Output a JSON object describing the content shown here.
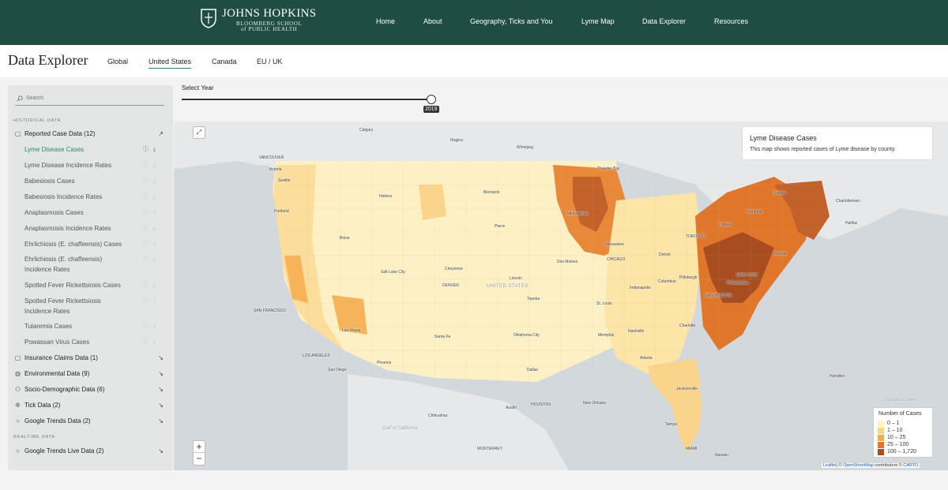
{
  "header": {
    "logo_title": "JOHNS HOPKINS",
    "logo_sub1": "BLOOMBERG SCHOOL",
    "logo_sub2": "of PUBLIC HEALTH",
    "nav": [
      "Home",
      "About",
      "Geography, Ticks and You",
      "Lyme Map",
      "Data Explorer",
      "Resources"
    ]
  },
  "subheader": {
    "title": "Data Explorer",
    "tabs": [
      "Global",
      "United States",
      "Canada",
      "EU / UK"
    ],
    "active_tab": "United States"
  },
  "year": {
    "label": "Select Year",
    "value": "2019"
  },
  "sidebar": {
    "search_placeholder": "Search",
    "historical_label": "HISTORICAL DATA",
    "realtime_label": "REALTIME DATA",
    "reported": {
      "label": "Reported Case Data (12)",
      "items": [
        "Lyme Disease Cases",
        "Lyme Disease Incidence Rates",
        "Babesiosis Cases",
        "Babesiosis Incidence Rates",
        "Anaplasmosis Cases",
        "Anaplasmosis Incidence Rates",
        "Ehrlichiosis (E. chaffeensis) Cases",
        "Ehrlichiosis (E. chaffeensis)",
        "Incidence Rates",
        "Spotted Fever Rickettsiosis Cases",
        "Spotted Fever Rickettsiosis",
        "Incidence Rates",
        "Tularemia Cases",
        "Powassan Virus Cases"
      ]
    },
    "groups": [
      "Insurance Claims Data (1)",
      "Environmental Data (9)",
      "Socio-Demographic Data (6)",
      "Tick Data (2)",
      "Google Trends Data (2)"
    ],
    "realtime_group": "Google Trends Live Data (2)"
  },
  "map": {
    "info_title": "Lyme Disease Cases",
    "info_desc": "This map shows reported cases of Lyme disease by county.",
    "legend_title": "Number of Cases",
    "legend": [
      {
        "label": "0 – 1",
        "color": "#fff3c4"
      },
      {
        "label": "1 – 10",
        "color": "#fbd48b"
      },
      {
        "label": "10 – 25",
        "color": "#f6a94a"
      },
      {
        "label": "25 – 100",
        "color": "#e0762a"
      },
      {
        "label": "100 – 1,720",
        "color": "#a84d1f"
      }
    ],
    "attribution_leaflet": "Leaflet",
    "attribution_osm": "OpenStreetMap",
    "attribution_mid": "| © ",
    "attribution_contrib": " contributors © ",
    "attribution_carto": "CARTO",
    "labels": {
      "calgary": "Calgary",
      "regina": "Regina",
      "winnipeg": "Winnipeg",
      "vancouver": "VANCOUVER",
      "victoria": "Victoria",
      "seattle": "Seattle",
      "portland": "Portland",
      "helena": "Helena",
      "bismarck": "Bismarck",
      "boise": "Boise",
      "pierre": "Pierre",
      "salt_lake": "Salt Lake City",
      "cheyenne": "Cheyenne",
      "denver": "DENVER",
      "united_states": "UNITED STATES",
      "san_francisco": "SAN FRANCISCO",
      "las_vegas": "Las Vegas",
      "los_angeles": "LOS ANGELES",
      "san_diego": "San Diego",
      "phoenix": "Phoenix",
      "santa_fe": "Santa Fe",
      "oklahoma_city": "Oklahoma City",
      "dallas": "Dallas",
      "austin": "Austin",
      "houston": "HOUSTON",
      "new_orleans": "New Orleans",
      "atlanta": "Atlanta",
      "nashville": "Nashville",
      "chicago": "CHICAGO",
      "milwaukee": "Milwaukee",
      "detroit": "Detroit",
      "toronto": "TORONTO",
      "ottawa": "Ottawa",
      "montreal": "Montréal",
      "quebec": "Québec",
      "boston": "Boston",
      "new_york": "NEW YORK",
      "philadelphia": "Philadelphia",
      "washington": "WASHINGTON",
      "pittsburgh": "Pittsburgh",
      "columbus": "Columbus",
      "indianapolis": "Indianapolis",
      "st_louis": "St. Louis",
      "minneapolis": "Minneapolis",
      "des_moines": "Des Moines",
      "lincoln": "Lincoln",
      "topeka": "Topeka",
      "memphis": "Memphis",
      "charlotte": "Charlotte",
      "jacksonville": "Jacksonville",
      "tampa": "Tampa",
      "miami": "MIAMI",
      "nassau": "Nassau",
      "chihuahua": "Chihuahua",
      "monterrey": "MONTERREY",
      "gulf": "Gulf of California",
      "thunder_bay": "Thunder Bay",
      "charlottetown": "Charlottetown",
      "halifax": "Halifax",
      "hamilton": "Hamilton",
      "sargasso": "Sargasso Sea"
    }
  }
}
